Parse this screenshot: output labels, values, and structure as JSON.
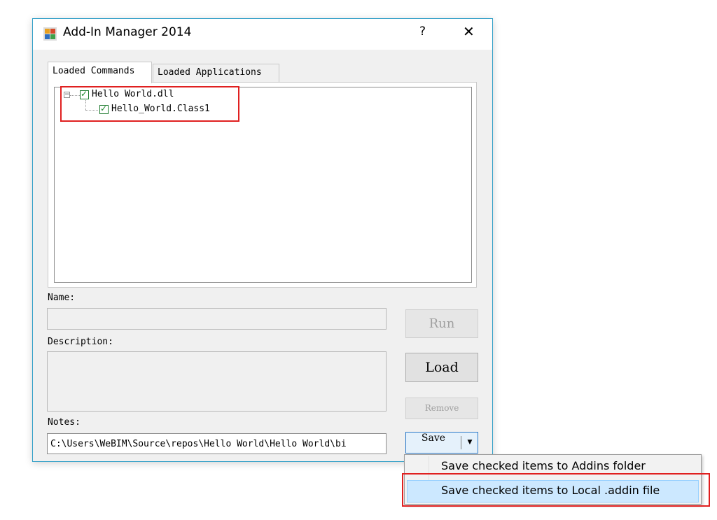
{
  "window": {
    "title": "Add-In Manager 2014",
    "help": "?",
    "close": "✕"
  },
  "tabs": [
    {
      "label": "Loaded Commands",
      "active": true
    },
    {
      "label": "Loaded Applications",
      "active": false
    }
  ],
  "tree": {
    "nodes": [
      {
        "label": "Hello World.dll",
        "checked": true,
        "expander": "−"
      },
      {
        "label": "Hello_World.Class1",
        "checked": true
      }
    ]
  },
  "fields": {
    "name_label": "Name:",
    "name_value": "",
    "description_label": "Description:",
    "description_value": "",
    "notes_label": "Notes:",
    "path_value": "C:\\Users\\WeBIM\\Source\\repos\\Hello World\\Hello World\\bi"
  },
  "buttons": {
    "run": "Run",
    "load": "Load",
    "remove": "Remove",
    "save": "Save",
    "save_dropdown": "▼"
  },
  "menu": {
    "items": [
      "Save checked items to Addins folder",
      "Save checked items to Local .addin file"
    ],
    "highlighted_index": 1
  },
  "colors": {
    "highlight": "#e02020",
    "menu_hover": "#cce8ff",
    "accent": "#2a78c8"
  }
}
